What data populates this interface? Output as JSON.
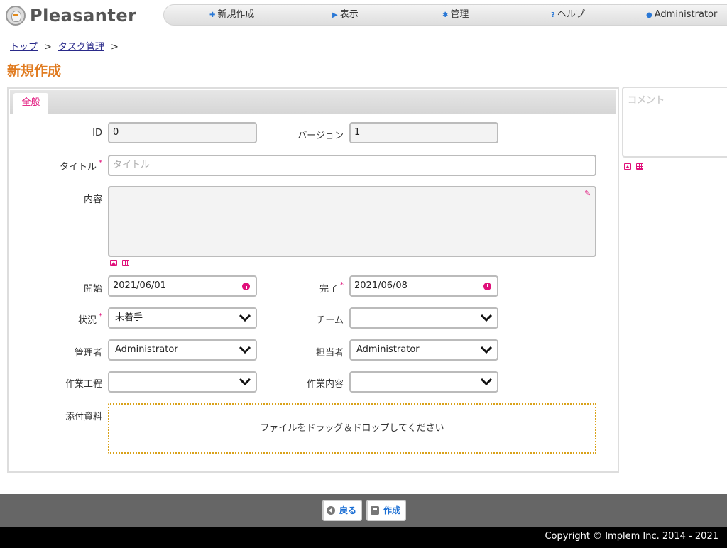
{
  "header": {
    "logo_text": "Pleasanter",
    "menu": [
      {
        "label": "新規作成",
        "icon": "plus-icon"
      },
      {
        "label": "表示",
        "icon": "triangle-right-icon"
      },
      {
        "label": "管理",
        "icon": "gear-icon"
      },
      {
        "label": "ヘルプ",
        "icon": "question-icon"
      },
      {
        "label": "Administrator",
        "icon": "user-icon"
      }
    ]
  },
  "breadcrumb": [
    {
      "label": "トップ"
    },
    {
      "label": "タスク管理"
    }
  ],
  "breadcrumb_separator": ">",
  "page_title": "新規作成",
  "tabs": [
    {
      "label": "全般"
    }
  ],
  "fields": {
    "id": {
      "label": "ID",
      "value": "0"
    },
    "version": {
      "label": "バージョン",
      "value": "1"
    },
    "title": {
      "label": "タイトル",
      "placeholder": "タイトル"
    },
    "body": {
      "label": "内容"
    },
    "start": {
      "label": "開始",
      "value": "2021/06/01"
    },
    "complete": {
      "label": "完了",
      "value": "2021/06/08"
    },
    "status": {
      "label": "状況",
      "value": "未着手"
    },
    "team": {
      "label": "チーム",
      "value": ""
    },
    "manager": {
      "label": "管理者",
      "value": "Administrator"
    },
    "owner": {
      "label": "担当者",
      "value": "Administrator"
    },
    "work_process": {
      "label": "作業工程",
      "value": ""
    },
    "work_content": {
      "label": "作業内容",
      "value": ""
    },
    "attachments": {
      "label": "添付資料",
      "dropzone_text": "ファイルをドラッグ＆ドロップしてください"
    }
  },
  "required_mark": "*",
  "comment": {
    "title": "コメント"
  },
  "commands": {
    "back": "戻る",
    "create": "作成"
  },
  "footer": {
    "copyright": "Copyright © Implem Inc. 2014 - 2021"
  },
  "colors": {
    "accent": "#e0107a",
    "title": "#e07b20",
    "link_blue": "#1a6ed4"
  }
}
